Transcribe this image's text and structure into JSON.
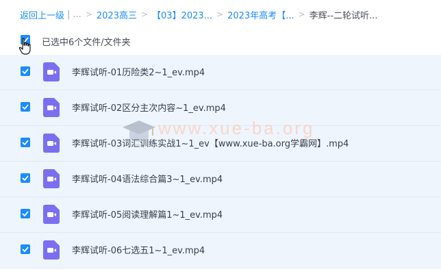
{
  "breadcrumb": {
    "back_label": "返回上一级",
    "back_divider": "|",
    "ellipsis": "...",
    "separator": ">",
    "items": [
      {
        "label": "2023高三"
      },
      {
        "label": "【03】2023..."
      },
      {
        "label": "2023年高考【..."
      }
    ],
    "current": "李辉--二轮试听..."
  },
  "selection": {
    "label": "已选中6个文件/文件夹",
    "all_checked": true
  },
  "files": [
    {
      "name": "李辉试听-01历险类2~1_ev.mp4",
      "checked": true,
      "icon": "video-file-icon"
    },
    {
      "name": "李辉试听-02区分主次内容~1_ev.mp4",
      "checked": true,
      "icon": "video-file-icon"
    },
    {
      "name": "李辉试听-03词汇训练实战1~1_ev【www.xue-ba.org学霸网】.mp4",
      "checked": true,
      "icon": "video-file-icon"
    },
    {
      "name": "李辉试听-04语法综合篇3~1_ev.mp4",
      "checked": true,
      "icon": "video-file-icon"
    },
    {
      "name": "李辉试听-05阅读理解篇1~1_ev.mp4",
      "checked": true,
      "icon": "video-file-icon"
    },
    {
      "name": "李辉试听-06七选五1~1_ev.mp4",
      "checked": true,
      "icon": "video-file-icon"
    }
  ],
  "watermark": {
    "text": "www.xue-ba.org"
  },
  "colors": {
    "accent": "#1a8cff",
    "row_background": "#eef5fd",
    "file_icon": "#7b6ff0"
  }
}
